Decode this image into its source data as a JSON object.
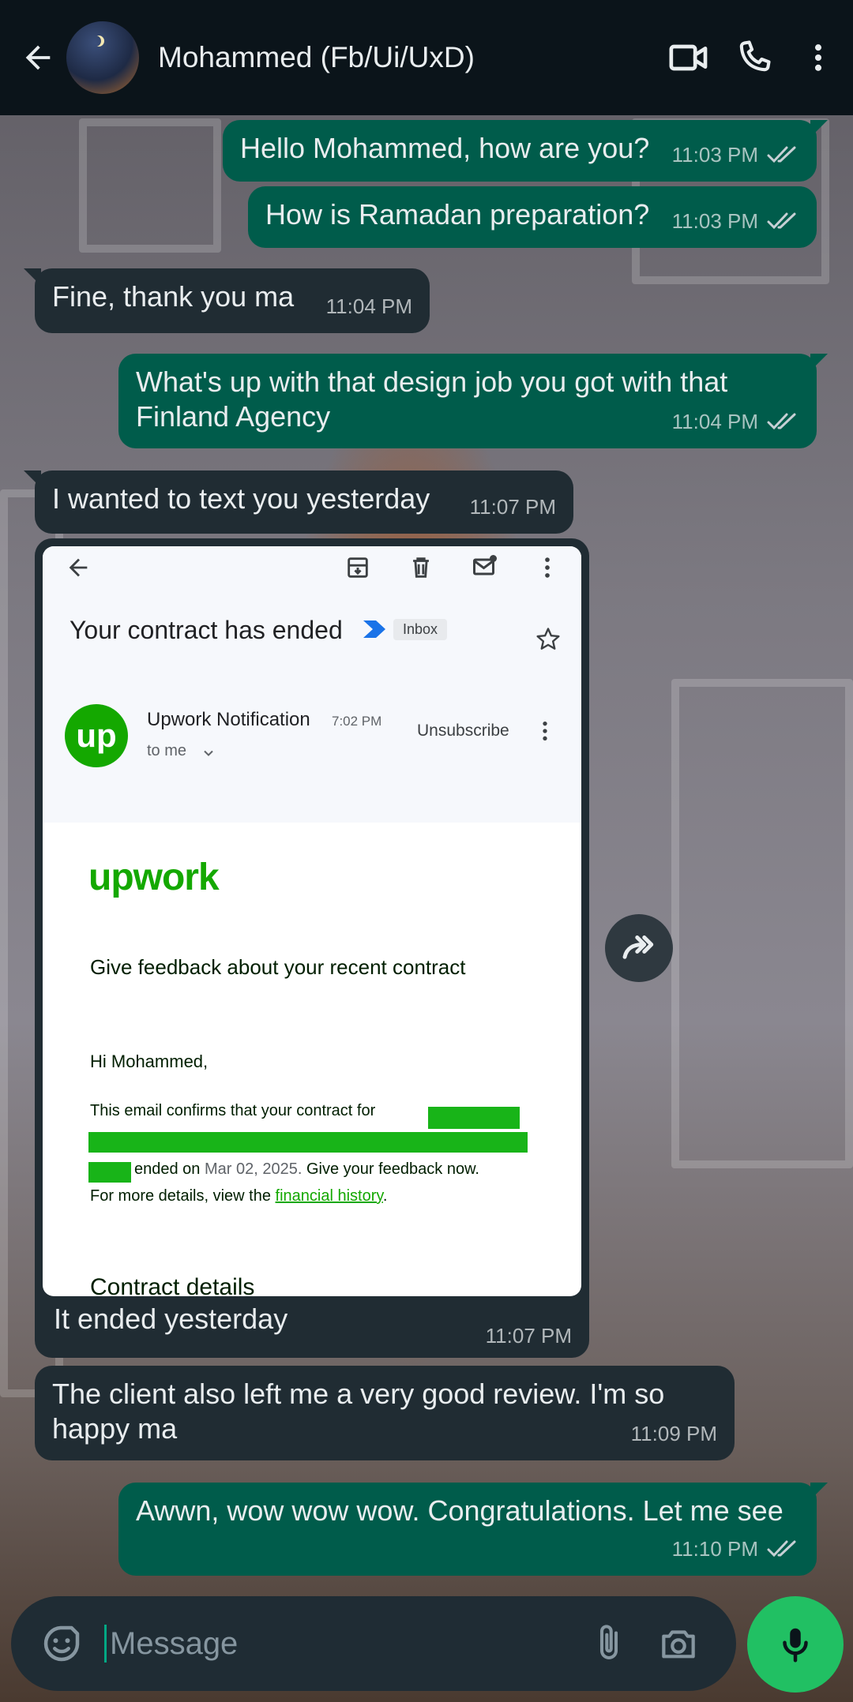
{
  "header": {
    "contact_name": "Mohammed (Fb/Ui/UxD)",
    "icons": [
      "back-arrow-icon",
      "video-call-icon",
      "voice-call-icon",
      "more-vertical-icon"
    ]
  },
  "messages": [
    {
      "dir": "out",
      "text": "Hello Mohammed, how are you?",
      "time": "11:03 PM",
      "status": "read"
    },
    {
      "dir": "out",
      "text": "How is Ramadan preparation?",
      "time": "11:03 PM",
      "status": "read"
    },
    {
      "dir": "in",
      "text": "Fine, thank you ma",
      "time": "11:04 PM"
    },
    {
      "dir": "out",
      "text": "What's up with that design  job you got with that Finland Agency",
      "time": "11:04 PM",
      "status": "read"
    },
    {
      "dir": "in",
      "text": "I wanted to text you yesterday",
      "time": "11:07 PM"
    },
    {
      "dir": "in",
      "type": "image",
      "caption": "It ended yesterday",
      "time": "11:07 PM"
    },
    {
      "dir": "in",
      "text": "The client also left me a very good review. I'm so happy ma",
      "time": "11:09 PM"
    },
    {
      "dir": "out",
      "text": "Awwn, wow wow wow. Congratulations. Let me see",
      "time": "11:10 PM",
      "status": "read"
    }
  ],
  "email_screenshot": {
    "subject": "Your contract has ended",
    "label": "Inbox",
    "sender": "Upwork Notification",
    "sent_time": "7:02 PM",
    "recipient": "to me",
    "unsubscribe": "Unsubscribe",
    "avatar_text": "up",
    "brand": "upwork",
    "heading": "Give feedback about your recent contract",
    "greeting": "Hi Mohammed,",
    "body_line1": "This email confirms that your contract for",
    "body_line3_a": "ended on",
    "body_date": "Mar 02, 2025.",
    "body_line3_b": "Give your feedback now.",
    "body_line4_a": "For more details, view the",
    "body_link": "financial history",
    "body_line4_b": ".",
    "section_title": "Contract details"
  },
  "composer": {
    "placeholder": "Message"
  },
  "colors": {
    "header_bg": "#0b141a",
    "outgoing_bubble": "#005c4b",
    "incoming_bubble": "#202c33",
    "mic_button": "#21c063",
    "upwork_green": "#14a800"
  }
}
